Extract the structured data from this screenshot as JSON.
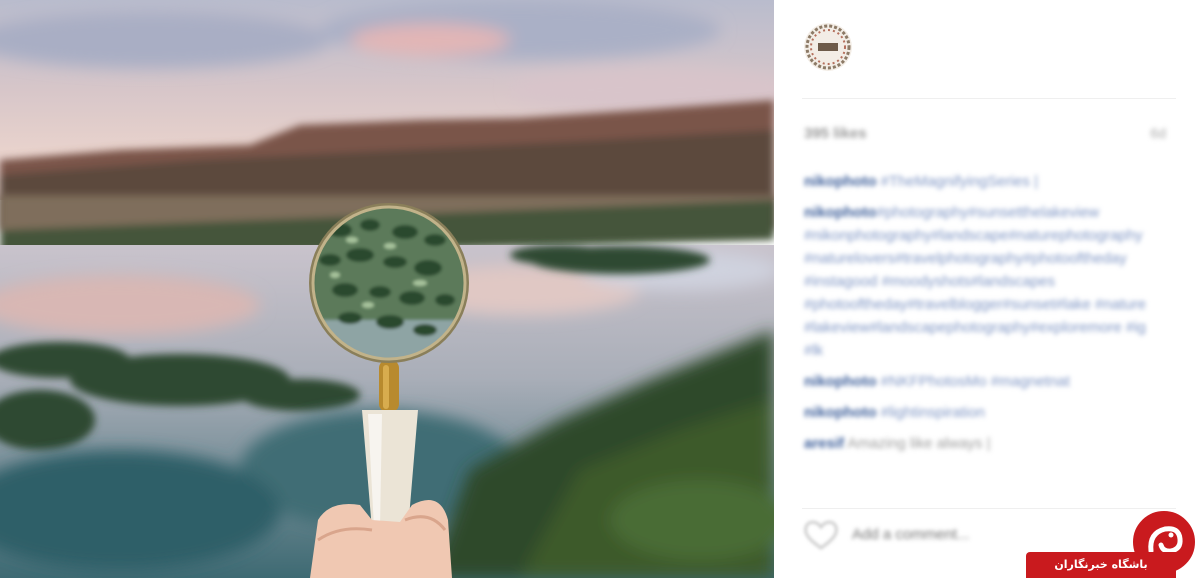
{
  "post": {
    "photo_alt": "hand holding magnifying glass over lake",
    "likes": "395 likes",
    "time_ago": "6d",
    "comments": [
      {
        "user": "nikophoto",
        "text": "#TheMagnifyingSeries |",
        "lines": []
      },
      {
        "user": "nikophoto",
        "text": "",
        "lines": [
          "#photography#sunsetthelakeview",
          "#nikonphotography#landscape#naturephotography",
          "#naturelovers#travelphotography#photooftheday",
          "#instagood #moodyshots#landscapes",
          "#photooftheday#travelblogger#sunset#lake #nature",
          "#lakeview#landscapephotography#exploremore #ig",
          "#lk"
        ]
      },
      {
        "user": "nikophoto",
        "text": "#NKFPhotosMo #magnetnat",
        "lines": []
      },
      {
        "user": "nikophoto",
        "text": "#lightinspiration",
        "lines": []
      },
      {
        "user": "aresif",
        "text": "Amazing like always |",
        "lines": [],
        "plain": true
      }
    ],
    "add_comment_placeholder": "Add a comment...",
    "more_label": "..."
  },
  "watermark": {
    "label": "باشگاه خبرنگاران"
  },
  "colors": {
    "brand_red": "#c91a1e",
    "username_blue": "#3b5d99",
    "hashtag_blue": "#7e95c4"
  },
  "icons": {
    "heart": "heart-icon",
    "avatar": "profile-avatar-icon",
    "watermark": "yjc-logo-icon"
  }
}
